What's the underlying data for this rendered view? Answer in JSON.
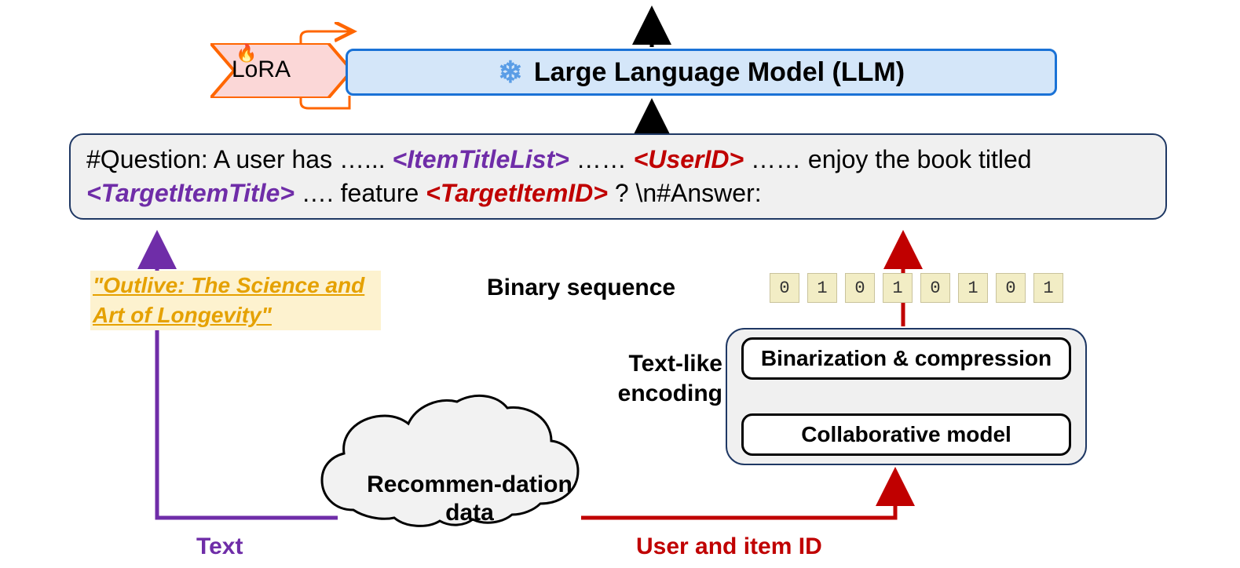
{
  "llm": {
    "label": "Large Language Model (LLM)"
  },
  "lora": {
    "label": "LoRA"
  },
  "prompt": {
    "prefix": "#Question: A user has …... ",
    "t1": "<ItemTitleList>",
    "m1": "…… ",
    "t2": "<UserID>",
    "m2": " …… enjoy the book titled ",
    "t3": "<TargetItemTitle>",
    "m3": " …. feature ",
    "t4": "<TargetItemID>",
    "suffix": "? \\n#Answer:"
  },
  "example": "\"Outlive: The Science and Art of Longevity\"",
  "binary": {
    "label": "Binary  sequence",
    "bits": [
      "0",
      "1",
      "0",
      "1",
      "0",
      "1",
      "0",
      "1"
    ]
  },
  "encoding": {
    "label": "Text-like encoding",
    "top": "Binarization & compression",
    "bottom": "Collaborative model"
  },
  "cloud": {
    "label": "Recommen-dation data"
  },
  "edges": {
    "text": "Text",
    "ids": "User and item ID"
  }
}
